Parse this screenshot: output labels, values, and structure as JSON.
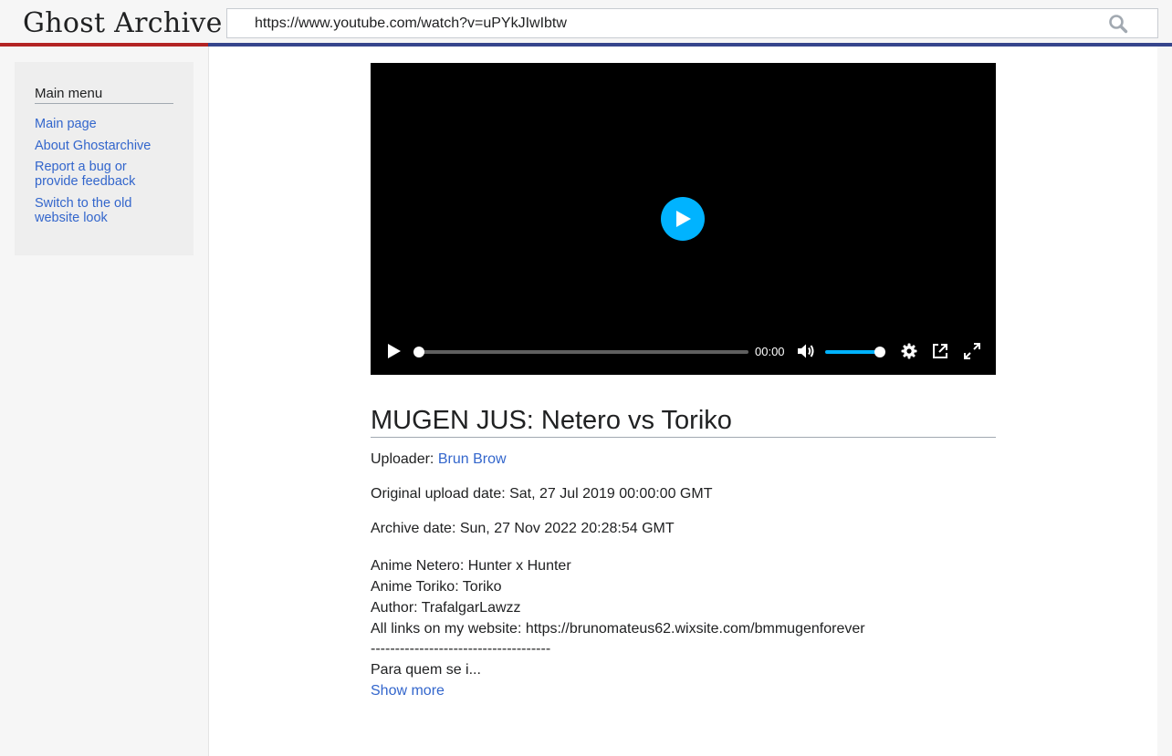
{
  "header": {
    "logo": "Ghost Archive",
    "search_value": "https://www.youtube.com/watch?v=uPYkJIwIbtw",
    "search_icon": "search-icon",
    "colors": {
      "logo_stripe": "#b32424",
      "main_stripe": "#36458c"
    }
  },
  "sidebar": {
    "heading": "Main menu",
    "items": [
      {
        "label": "Main page"
      },
      {
        "label": "About Ghostarchive"
      },
      {
        "label": "Report a bug or provide feedback"
      },
      {
        "label": "Switch to the old website look"
      }
    ]
  },
  "player": {
    "time": "00:00",
    "progress": 0,
    "volume": 1,
    "accent_color": "#00b3ff",
    "icons": [
      "play-icon",
      "volume-icon",
      "settings-icon",
      "picture-in-picture-icon",
      "fullscreen-icon"
    ]
  },
  "video": {
    "title": "MUGEN JUS: Netero vs Toriko",
    "uploader_label": "Uploader:",
    "uploader": "Brun Brow",
    "upload_date": "Original upload date: Sat, 27 Jul 2019 00:00:00 GMT",
    "archive_date": "Archive date: Sun, 27 Nov 2022 20:28:54 GMT",
    "description": [
      "Anime Netero: Hunter x Hunter",
      "Anime Toriko: Toriko",
      "Author: TrafalgarLawzz",
      "All links on my website: https://brunomateus62.wixsite.com/bmmugenforever",
      "-------------------------------------",
      "Para quem se i..."
    ],
    "show_more": "Show more"
  }
}
